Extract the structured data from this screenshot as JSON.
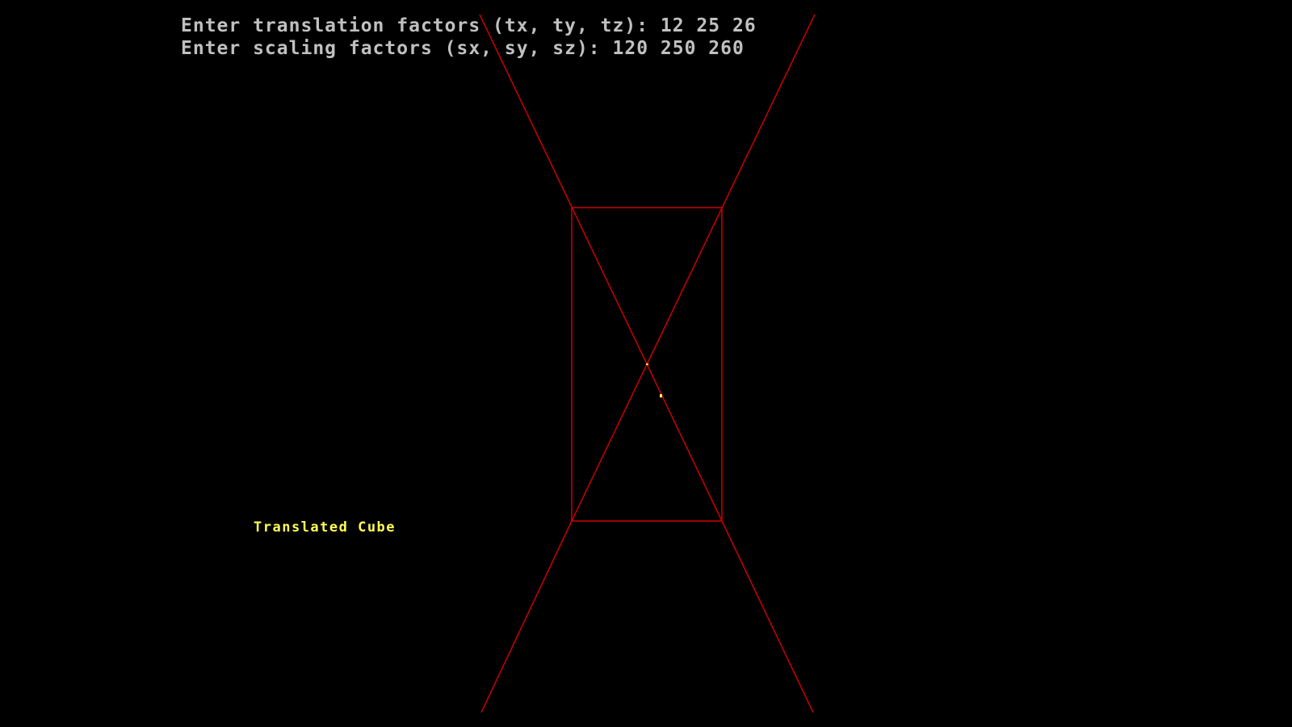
{
  "console": {
    "translation_prompt": "Enter translation factors (tx, ty, tz): ",
    "translation_input": "12 25 26",
    "scaling_prompt": "Enter scaling factors (sx, sy, sz): ",
    "scaling_input": "120 250 260"
  },
  "caption": {
    "label": "Translated Cube"
  },
  "colors": {
    "background": "#000000",
    "console_text": "#c0c0c0",
    "caption_text": "#ffff55",
    "cube_lines": "#c00000",
    "marker": "#ffff55"
  }
}
